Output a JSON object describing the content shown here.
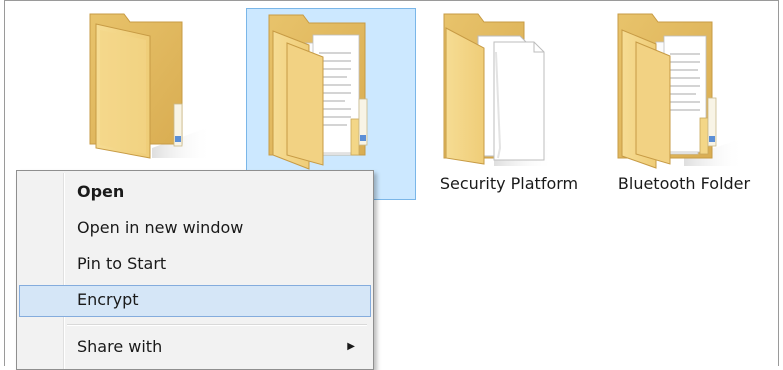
{
  "folders": [
    {
      "name": "",
      "selected": false
    },
    {
      "name": "",
      "selected": true
    },
    {
      "name": "Security Platform",
      "selected": false
    },
    {
      "name": "Bluetooth Folder",
      "selected": false
    }
  ],
  "context_menu": {
    "items": [
      {
        "label": "Open",
        "bold": true
      },
      {
        "label": "Open in new window"
      },
      {
        "label": "Pin to Start"
      },
      {
        "label": "Encrypt",
        "highlighted": true
      },
      {
        "label": "Share with",
        "has_submenu": true
      }
    ]
  },
  "colors": {
    "folder_yellow": "#f1cf78",
    "selection_blue": "#cce8ff",
    "menu_highlight": "#d5e6f7"
  }
}
